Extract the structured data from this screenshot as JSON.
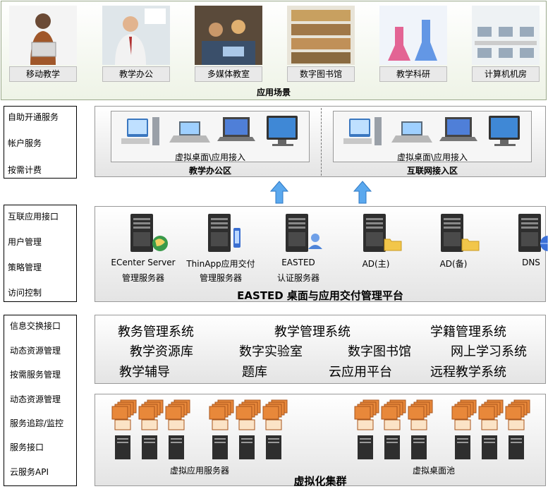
{
  "scenes": {
    "items": [
      {
        "label": "移动教学"
      },
      {
        "label": "教学办公"
      },
      {
        "label": "多媒体教室"
      },
      {
        "label": "数字图书馆"
      },
      {
        "label": "教学科研"
      },
      {
        "label": "计算机机房"
      }
    ],
    "title": "应用场景"
  },
  "left_column": {
    "group1": [
      "自助开通服务",
      "帐户服务",
      "按需计费"
    ],
    "group2": [
      "互联应用接口",
      "用户管理",
      "策略管理",
      "访问控制"
    ],
    "group3": [
      "信息交换接口",
      "动态资源管理",
      "按需服务管理",
      "动态资源管理",
      "服务追踪/监控",
      "服务接口",
      "云服务API"
    ]
  },
  "zones": {
    "office": {
      "devices_label": "虚拟桌面\\应用接入",
      "title": "教学办公区"
    },
    "internet": {
      "devices_label": "虚拟桌面\\应用接入",
      "title": "互联网接入区"
    }
  },
  "platform": {
    "servers": [
      {
        "line1": "ECenter Server",
        "line2": "管理服务器",
        "icon": "globe"
      },
      {
        "line1": "ThinApp应用交付",
        "line2": "管理服务器",
        "icon": "phone"
      },
      {
        "line1": "EASTED",
        "line2": "认证服务器",
        "icon": "user"
      },
      {
        "line1": "AD(主)",
        "line2": "",
        "icon": "folder"
      },
      {
        "line1": "AD(备)",
        "line2": "",
        "icon": "folder"
      },
      {
        "line1": "DNS",
        "line2": "",
        "icon": "globe-blue"
      }
    ],
    "title": "EASTED 桌面与应用交付管理平台"
  },
  "systems": {
    "row1": [
      "教务管理系统",
      "教学管理系统",
      "学籍管理系统"
    ],
    "row2": [
      "教学资源库",
      "数字实验室",
      "数字图书馆",
      "网上学习系统"
    ],
    "row3": [
      "教学辅导",
      "题库",
      "云应用平台",
      "远程教学系统"
    ]
  },
  "cluster": {
    "app_servers_label": "虚拟应用服务器",
    "desktop_pool_label": "虚拟桌面池",
    "title": "虚拟化集群"
  },
  "colors": {
    "arrow": "#3d8fd6",
    "server_dark": "#2e2e2e",
    "app_card": "#e8883a"
  }
}
